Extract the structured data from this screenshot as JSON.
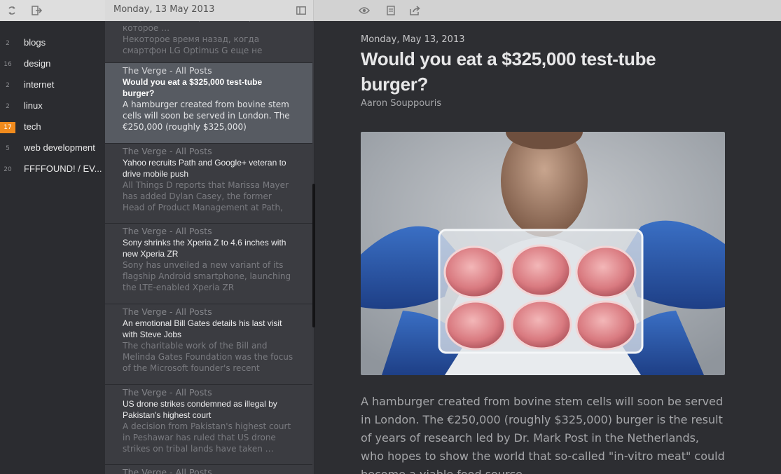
{
  "toolbar": {
    "refresh_icon": "refresh-icon",
    "logout_icon": "logout-icon",
    "date": "Monday, 13 May 2013",
    "layout_icon": "layout-toggle-icon",
    "view_icon": "eye-icon",
    "read_icon": "document-icon",
    "share_icon": "share-icon"
  },
  "sidebar": {
    "items": [
      {
        "count": "2",
        "label": "blogs"
      },
      {
        "count": "16",
        "label": "design"
      },
      {
        "count": "2",
        "label": "internet"
      },
      {
        "count": "2",
        "label": "linux"
      },
      {
        "count": "17",
        "label": "tech",
        "highlight": true
      },
      {
        "count": "5",
        "label": "web development"
      },
      {
        "count": "20",
        "label": "FFFFOUND! / EV..."
      }
    ]
  },
  "list": {
    "partial": {
      "title": "подробное тестирование Сяраш, которое …",
      "summary": "Некоторое время назад, когда смартфон LG Optimus G еще не"
    },
    "items": [
      {
        "source": "The Verge - All Posts",
        "title": "Would you eat a $325,000 test-tube burger?",
        "summary": "A hamburger created from bovine stem cells will soon be served in London. The €250,000 (roughly $325,000)"
      },
      {
        "source": "The Verge - All Posts",
        "title": "Yahoo recruits Path and Google+ veteran to drive mobile push",
        "summary": "All Things D reports that Marissa Mayer has added Dylan Casey, the former Head of Product Management at Path,"
      },
      {
        "source": "The Verge - All Posts",
        "title": "Sony shrinks the Xperia Z to 4.6 inches with new Xperia ZR",
        "summary": "Sony has unveiled a new variant of its flagship Android smartphone, launching the LTE-enabled Xperia ZR"
      },
      {
        "source": "The Verge - All Posts",
        "title": "An emotional Bill Gates details his last visit with Steve Jobs",
        "summary": "The charitable work of the Bill and Melinda Gates Foundation was the focus of the Microsoft founder's recent"
      },
      {
        "source": "The Verge - All Posts",
        "title": "US drone strikes condemned as illegal by Pakistan's highest court",
        "summary": "A decision from Pakistan's highest court in Peshawar has ruled that US drone strikes on tribal lands have taken …"
      },
      {
        "source": "The Verge - All Posts"
      }
    ]
  },
  "article": {
    "date": "Monday, May 13, 2013",
    "title": "Would you eat a $325,000 test-tube burger?",
    "author": "Aaron Souppouris",
    "body": "A hamburger created from bovine stem cells will soon be served in London. The €250,000 (roughly $325,000) burger is the result of years of research led by Dr. Mark Post in the Netherlands, who hopes to show the world that so-called \"in-vitro meat\" could become a viable food source."
  },
  "colors": {
    "accent": "#f18b1d",
    "selected": "#575b62"
  }
}
